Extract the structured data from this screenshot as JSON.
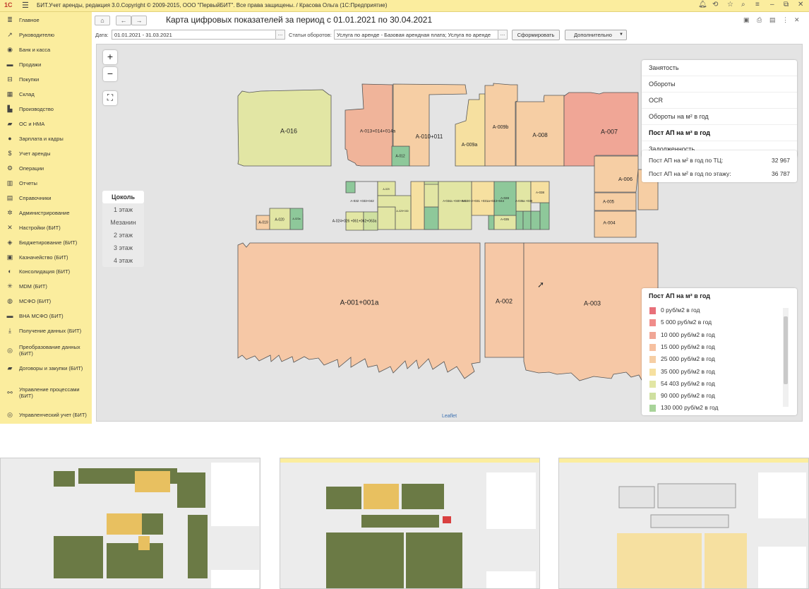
{
  "titlebar": {
    "logo": "1С",
    "title": "БИТ.Учет аренды, редакция 3.0.Copyright © 2009-2015, ООО \"ПервыйБИТ\". Все права защищены. / Красова Ольга  (1С:Предприятие)"
  },
  "sidebar": {
    "items": [
      {
        "label": "Главное",
        "icon": "list-icon"
      },
      {
        "label": "Руководителю",
        "icon": "chart-trend-icon"
      },
      {
        "label": "Банк и касса",
        "icon": "bank-icon"
      },
      {
        "label": "Продажи",
        "icon": "sales-icon"
      },
      {
        "label": "Покупки",
        "icon": "cart-icon"
      },
      {
        "label": "Склад",
        "icon": "warehouse-icon"
      },
      {
        "label": "Производство",
        "icon": "factory-icon"
      },
      {
        "label": "ОС и НМА",
        "icon": "truck-icon"
      },
      {
        "label": "Зарплата и кадры",
        "icon": "person-icon"
      },
      {
        "label": "Учет аренды",
        "icon": "rent-icon"
      },
      {
        "label": "Операции",
        "icon": "operations-icon"
      },
      {
        "label": "Отчеты",
        "icon": "reports-icon"
      },
      {
        "label": "Справочники",
        "icon": "book-icon"
      },
      {
        "label": "Администрирование",
        "icon": "gear-icon"
      },
      {
        "label": "Настройки (БИТ)",
        "icon": "tools-icon"
      },
      {
        "label": "Бюджетирование (БИТ)",
        "icon": "budget-icon"
      },
      {
        "label": "Казначейство (БИТ)",
        "icon": "treasury-icon"
      },
      {
        "label": "Консолидация (БИТ)",
        "icon": "consolidation-icon"
      },
      {
        "label": "MDM (БИТ)",
        "icon": "mdm-icon"
      },
      {
        "label": "МСФО (БИТ)",
        "icon": "globe-icon"
      },
      {
        "label": "ВНА МСФО (БИТ)",
        "icon": "assets-icon"
      },
      {
        "label": "Получение данных (БИТ)",
        "icon": "download-icon"
      },
      {
        "label": "Преобразование данных (БИТ)",
        "icon": "transform-icon"
      },
      {
        "label": "Договоры и закупки (БИТ)",
        "icon": "folder-icon"
      },
      {
        "label": "Управление процессами (БИТ)",
        "icon": "process-icon"
      },
      {
        "label": "Управленческий учет (БИТ)",
        "icon": "target-icon"
      }
    ]
  },
  "toolbar": {
    "title": "Карта цифровых показателей за период с 01.01.2021 по 30.04.2021",
    "date_label": "Дата:",
    "date_value": "01.01.2021 - 31.03.2021",
    "turnover_label": "Статьи оборотов:",
    "turnover_value": "Услуга по аренде - Базовая арендная плата; Услуга по аренде",
    "ellipsis": "...",
    "form_button": "Сформировать",
    "more_button": "Дополнительно"
  },
  "map": {
    "zoom_in": "+",
    "zoom_out": "−",
    "attribution": "Leaflet",
    "floors": [
      "Цоколь",
      "1 этаж",
      "Мезанин",
      "2 этаж",
      "3 этаж",
      "4 этаж"
    ],
    "selected_floor": "Цоколь",
    "layers": [
      "Занятость",
      "Обороты",
      "OCR",
      "Обороты на м² в год",
      "Пост АП на м² в год",
      "Задолженность"
    ],
    "selected_layer": "Пост АП на м² в год",
    "stats": [
      {
        "label": "Пост АП на м² в год по ТЦ:",
        "value": "32 967"
      },
      {
        "label": "Пост АП на м² в год по этажу:",
        "value": "36 787"
      }
    ],
    "units": [
      {
        "label": "A-016",
        "color": "#e2e6a4"
      },
      {
        "label": "A-013+014+014a",
        "color": "#f0b49a"
      },
      {
        "label": "A-012",
        "color": "#8ec89a"
      },
      {
        "label": "A-010+011",
        "color": "#f6cea4"
      },
      {
        "label": "A-009a",
        "color": "#f6e0a0"
      },
      {
        "label": "A-009b",
        "color": "#f6cea4"
      },
      {
        "label": "A-008",
        "color": "#f6cea4"
      },
      {
        "label": "A-007",
        "color": "#f0a696"
      },
      {
        "label": "A-006",
        "color": "#f6cea4"
      },
      {
        "label": "A-005",
        "color": "#f6cea4"
      },
      {
        "label": "A-004",
        "color": "#f6cea4"
      },
      {
        "label": "A-001+001a",
        "color": "#f6c8a6"
      },
      {
        "label": "A-002",
        "color": "#f6c8a6"
      },
      {
        "label": "A-003",
        "color": "#f6c8a6"
      },
      {
        "label": "A-019",
        "color": "#f6cea4"
      },
      {
        "label": "A-020",
        "color": "#e2e6a4"
      },
      {
        "label": "A-023a",
        "color": "#8ec89a"
      },
      {
        "label": "A-024+026 +061+062+063a",
        "color": "#e2e6a4"
      },
      {
        "label": "A-032 +033+042",
        "color": "#cfe0a0"
      },
      {
        "label": "A-030-2+031 +031a+043+044",
        "color": "#f6e0a0"
      },
      {
        "label": "A-034a +040+041",
        "color": "#e2e6a4"
      },
      {
        "label": "A-035a +039",
        "color": "#e2e6a4"
      },
      {
        "label": "A-035",
        "color": "#e2e6a4"
      },
      {
        "label": "A-038",
        "color": "#f6e0a0"
      },
      {
        "label": "A-029",
        "color": "#e2e6a4"
      },
      {
        "label": "A-029+030",
        "color": "#e2e6a4"
      },
      {
        "label": "A-028",
        "color": "#8ec89a"
      }
    ]
  },
  "legend": {
    "title": "Пост АП на м² в год",
    "items": [
      {
        "label": "0 руб/м2 в год",
        "color": "#e8707a"
      },
      {
        "label": "5 000 руб/м2 в год",
        "color": "#f08c8a"
      },
      {
        "label": "10 000 руб/м2 в год",
        "color": "#f0a696"
      },
      {
        "label": "15 000 руб/м2 в год",
        "color": "#f6c0a0"
      },
      {
        "label": "25 000 руб/м2 в год",
        "color": "#f6cea4"
      },
      {
        "label": "35 000 руб/м2 в год",
        "color": "#f6e0a0"
      },
      {
        "label": "54 403 руб/м2 в год",
        "color": "#e2e6a4"
      },
      {
        "label": "90 000 руб/м2 в год",
        "color": "#cfe0a0"
      },
      {
        "label": "130 000 руб/м2 в год",
        "color": "#a8d49a"
      }
    ]
  }
}
